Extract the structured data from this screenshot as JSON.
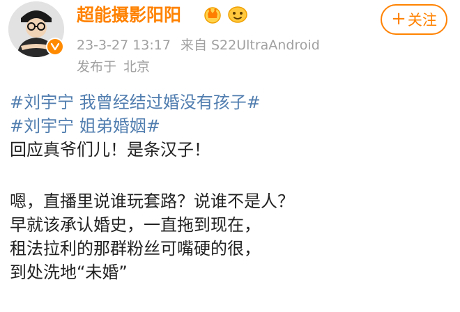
{
  "colors": {
    "username": "#ff8200",
    "meta": "#a0a0a0",
    "hashtag": "#507daf",
    "body_text": "#222222",
    "follow_border": "#ff8200"
  },
  "user": {
    "name": "超能摄影阳阳",
    "avatar_icon": "avatar-illustration",
    "verified_icon": "verified-badge-icon",
    "level_icons": [
      "crown-level-icon",
      "fan-face-icon"
    ]
  },
  "meta": {
    "timestamp": "23-3-27 13:17",
    "source_prefix": "来自",
    "source": "S22UltraAndroid",
    "posted_prefix": "发布于",
    "location": "北京"
  },
  "follow": {
    "plus": "+",
    "label": "关注"
  },
  "post": {
    "hashtag1": "#刘宇宁 我曾经结过婚没有孩子#",
    "hashtag2": "#刘宇宁 姐弟婚姻#",
    "line1": "回应真爷们儿！是条汉子！",
    "line2": "嗯，直播里说谁玩套路？说谁不是人？",
    "line3": "早就该承认婚史，一直拖到现在，",
    "line4": "租法拉利的那群粉丝可嘴硬的很，",
    "line5": "到处洗地“未婚”"
  }
}
